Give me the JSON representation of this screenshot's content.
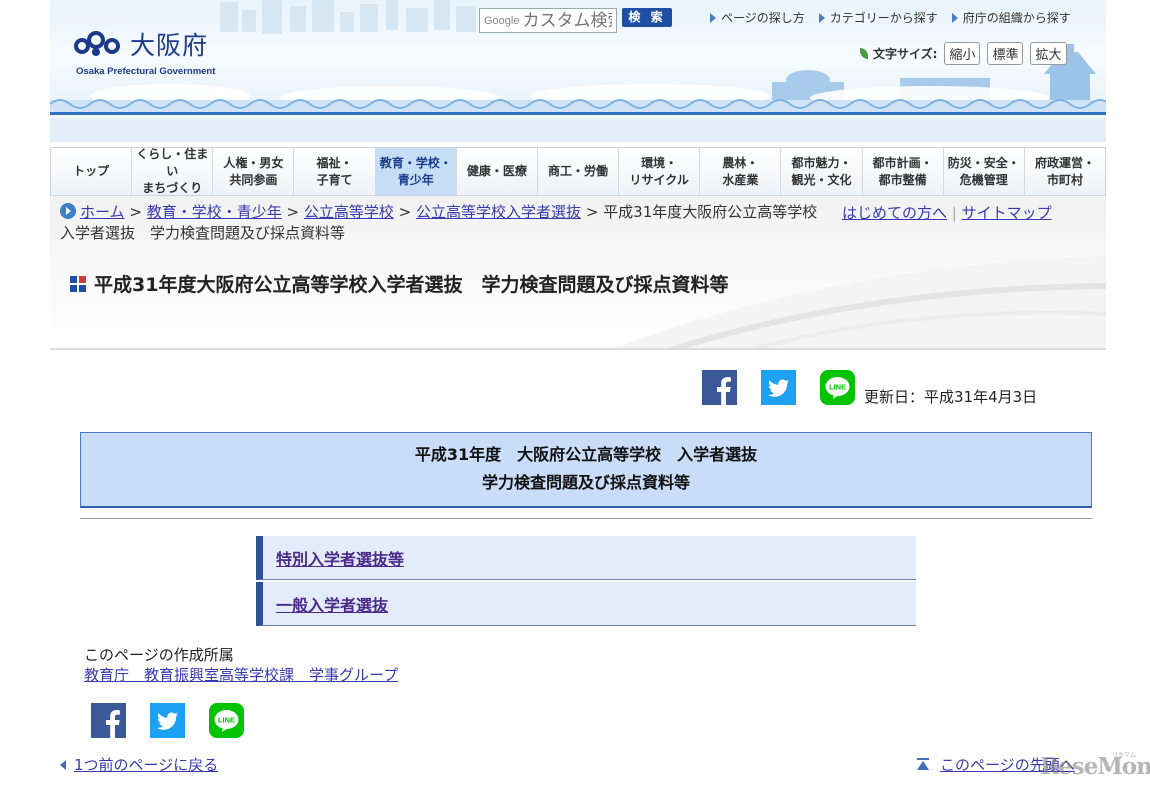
{
  "header": {
    "logo_text": "大阪府",
    "logo_subtitle": "Osaka Prefectural Government",
    "search": {
      "brand": "Google",
      "placeholder": "カスタム検索",
      "button_label": "検 索"
    },
    "top_links": [
      "ページの探し方",
      "カテゴリーから探す",
      "府庁の組織から探す"
    ],
    "font_size": {
      "label": "文字サイズ:",
      "buttons": [
        "縮小",
        "標準",
        "拡大"
      ]
    }
  },
  "nav": {
    "items": [
      "トップ",
      "くらし・住まい\nまちづくり",
      "人権・男女\n共同参画",
      "福祉・\n子育て",
      "教育・学校・\n青少年",
      "健康・医療",
      "商工・労働",
      "環境・\nリサイクル",
      "農林・\n水産業",
      "都市魅力・\n観光・文化",
      "都市計画・\n都市整備",
      "防災・安全・\n危機管理",
      "府政運営・\n市町村"
    ],
    "active_index": 4
  },
  "breadcrumb": {
    "items": [
      "ホーム",
      "教育・学校・青少年",
      "公立高等学校",
      "公立高等学校入学者選抜"
    ],
    "separator": ">",
    "current": "平成31年度大阪府公立高等学校入学者選抜　学力検査問題及び採点資料等",
    "side_links": [
      "はじめての方へ",
      "サイトマップ"
    ]
  },
  "page_title": "平成31年度大阪府公立高等学校入学者選抜　学力検査問題及び採点資料等",
  "social": {
    "icons": [
      "facebook-icon",
      "twitter-icon",
      "line-icon"
    ],
    "line_label": "LINE"
  },
  "updated": "更新日：平成31年4月3日",
  "main": {
    "heading_line1": "平成31年度　大阪府公立高等学校　入学者選抜",
    "heading_line2": "学力検査問題及び採点資料等",
    "links": [
      "特別入学者選抜等",
      "一般入学者選抜"
    ]
  },
  "owner": {
    "label": "このページの作成所属",
    "link": "教育庁　教育振興室高等学校課　学事グループ"
  },
  "footer": {
    "back": "1つ前のページに戻る",
    "top": "このページの先頭へ"
  },
  "watermark": {
    "text": "ReseMom",
    "small": "リセマム"
  },
  "colors": {
    "accent": "#1f4fa3",
    "nav_active": "#c5ddf5",
    "heading_box": "#c9dcf8",
    "link": "#3a3ab0"
  }
}
